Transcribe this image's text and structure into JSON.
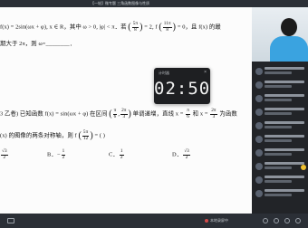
{
  "window": {
    "title": "【一轮】微专题 三角函数图像与性质"
  },
  "document": {
    "line1": {
      "pre": "f(x) = 2sin(ωx + φ), x ∈ R，其中 ω > 0, |φ| < π．若",
      "frac1_num": "5π",
      "frac1_den": "8",
      "mid1": "= 2, f",
      "frac2_num": "11π",
      "frac2_den": "8",
      "post": "= 0，且 f(x) 的最"
    },
    "line2": "期大于 2π，则 ω=________．",
    "line3": {
      "pre": "3 乙卷) 已知函数 f(x) = sin(ωx + φ) 在区间",
      "int_a_num": "π",
      "int_a_den": "6",
      "int_b_num": "2π",
      "int_b_den": "3",
      "mid": "单调递增，直线 x =",
      "l1_num": "π",
      "l1_den": "6",
      "and": "和 x =",
      "l2_num": "2π",
      "l2_den": "3",
      "post": "为函数"
    },
    "line4": {
      "pre": "(x) 的图像的两条对称轴，则 f",
      "q_num": "5π",
      "q_den": "12",
      "post": "= (        )"
    },
    "options": {
      "a_num": "√3",
      "a_den": "2",
      "b_label": "B．−",
      "b_num": "1",
      "b_den": "2",
      "c_label": "C．",
      "c_num": "1",
      "c_den": "2",
      "d_label": "D．",
      "d_num": "√3",
      "d_den": "2"
    }
  },
  "timer": {
    "label": "计时器",
    "value": "02:50",
    "close": "×"
  },
  "bottom": {
    "status": "本地录屏中"
  }
}
